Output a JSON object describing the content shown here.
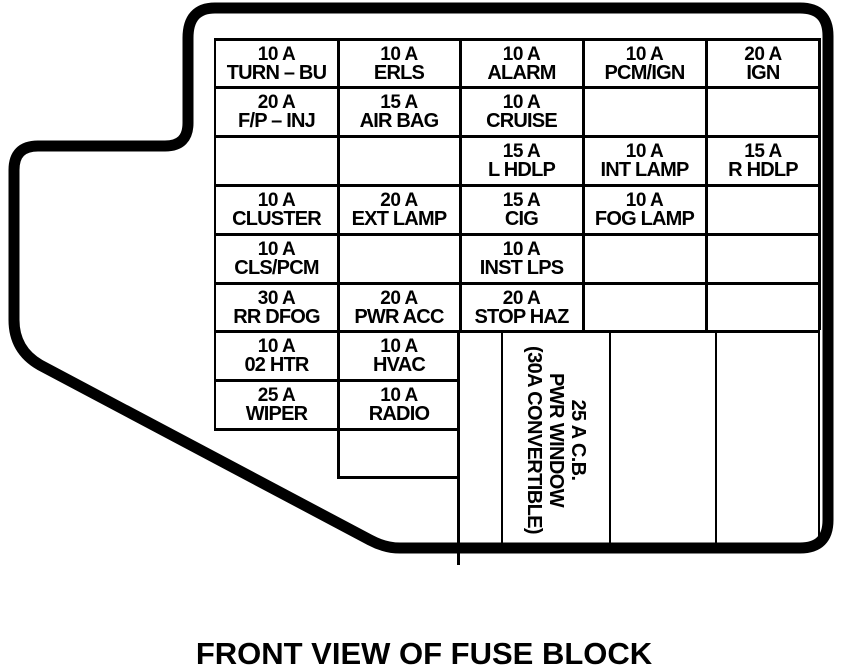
{
  "caption": "FRONT VIEW OF FUSE BLOCK",
  "fuses": [
    {
      "id": "r1c1",
      "amp": "10 A",
      "name": "TURN – BU"
    },
    {
      "id": "r1c2",
      "amp": "10 A",
      "name": "ERLS"
    },
    {
      "id": "r1c3",
      "amp": "10 A",
      "name": "ALARM"
    },
    {
      "id": "r1c4",
      "amp": "10 A",
      "name": "PCM/IGN"
    },
    {
      "id": "r1c5",
      "amp": "20 A",
      "name": "IGN"
    },
    {
      "id": "r2c1",
      "amp": "20 A",
      "name": "F/P – INJ"
    },
    {
      "id": "r2c2",
      "amp": "15 A",
      "name": "AIR BAG"
    },
    {
      "id": "r2c3",
      "amp": "10 A",
      "name": "CRUISE"
    },
    {
      "id": "r2c4",
      "amp": "",
      "name": ""
    },
    {
      "id": "r2c5",
      "amp": "",
      "name": ""
    },
    {
      "id": "r3c1",
      "amp": "",
      "name": ""
    },
    {
      "id": "r3c2",
      "amp": "",
      "name": ""
    },
    {
      "id": "r3c3",
      "amp": "15 A",
      "name": "L HDLP"
    },
    {
      "id": "r3c4",
      "amp": "10 A",
      "name": "INT LAMP"
    },
    {
      "id": "r3c5",
      "amp": "15 A",
      "name": "R HDLP"
    },
    {
      "id": "r4c1",
      "amp": "10 A",
      "name": "CLUSTER"
    },
    {
      "id": "r4c2",
      "amp": "20 A",
      "name": "EXT LAMP"
    },
    {
      "id": "r4c3",
      "amp": "15 A",
      "name": "CIG"
    },
    {
      "id": "r4c4",
      "amp": "10 A",
      "name": "FOG LAMP"
    },
    {
      "id": "r4c5",
      "amp": "",
      "name": ""
    },
    {
      "id": "r5c1",
      "amp": "10 A",
      "name": "CLS/PCM"
    },
    {
      "id": "r5c2",
      "amp": "",
      "name": ""
    },
    {
      "id": "r5c3",
      "amp": "10 A",
      "name": "INST LPS"
    },
    {
      "id": "r5c4",
      "amp": "",
      "name": ""
    },
    {
      "id": "r5c5",
      "amp": "",
      "name": ""
    },
    {
      "id": "r6c1",
      "amp": "30 A",
      "name": "RR DFOG"
    },
    {
      "id": "r6c2",
      "amp": "20 A",
      "name": "PWR ACC"
    },
    {
      "id": "r6c3",
      "amp": "20 A",
      "name": "STOP HAZ"
    },
    {
      "id": "r6c4",
      "amp": "",
      "name": ""
    },
    {
      "id": "r6c5",
      "amp": "",
      "name": ""
    },
    {
      "id": "r7c1",
      "amp": "10 A",
      "name": "02 HTR"
    },
    {
      "id": "r7c2",
      "amp": "10 A",
      "name": "HVAC"
    },
    {
      "id": "r8c1",
      "amp": "25 A",
      "name": "WIPER"
    },
    {
      "id": "r8c2",
      "amp": "10 A",
      "name": "RADIO"
    },
    {
      "id": "r9c2",
      "amp": "",
      "name": ""
    }
  ],
  "circuit_breaker": {
    "line1": "25 A C.B.",
    "line2": "PWR WINDOW",
    "line3": "(30A CONVERTIBLE)"
  }
}
